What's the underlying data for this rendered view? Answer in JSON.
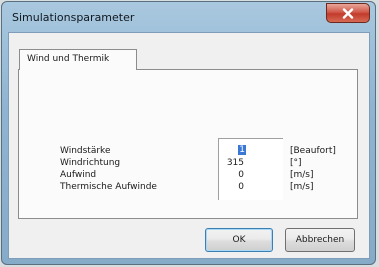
{
  "window": {
    "title": "Simulationsparameter",
    "close_icon": "close-icon"
  },
  "tabs": [
    {
      "label": "Wind und Thermik",
      "selected": true
    }
  ],
  "fields": [
    {
      "label": "Windstärke",
      "value": "1",
      "unit": "[Beaufort]",
      "selected": true
    },
    {
      "label": "Windrichtung",
      "value": "315",
      "unit": "[°]"
    },
    {
      "label": "Aufwind",
      "value": "0",
      "unit": "[m/s]"
    },
    {
      "label": "Thermische Aufwinde",
      "value": "0",
      "unit": "[m/s]"
    }
  ],
  "buttons": {
    "ok_label": "OK",
    "cancel_label": "Abbrechen"
  },
  "colors": {
    "selection": "#3a78d6",
    "close_button": "#c23a2a"
  }
}
